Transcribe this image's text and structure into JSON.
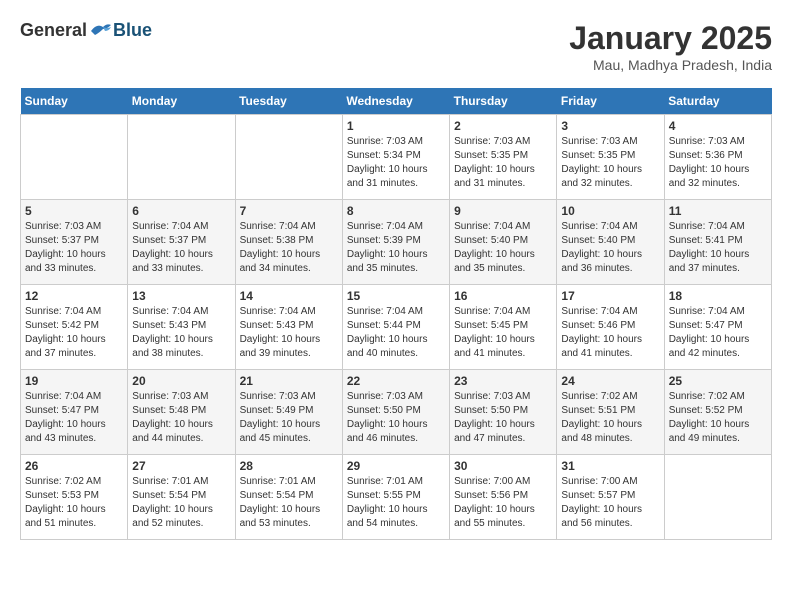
{
  "header": {
    "logo": {
      "general": "General",
      "blue": "Blue"
    },
    "title": "January 2025",
    "location": "Mau, Madhya Pradesh, India"
  },
  "days_of_week": [
    "Sunday",
    "Monday",
    "Tuesday",
    "Wednesday",
    "Thursday",
    "Friday",
    "Saturday"
  ],
  "weeks": [
    [
      {
        "day": "",
        "info": ""
      },
      {
        "day": "",
        "info": ""
      },
      {
        "day": "",
        "info": ""
      },
      {
        "day": "1",
        "info": "Sunrise: 7:03 AM\nSunset: 5:34 PM\nDaylight: 10 hours\nand 31 minutes."
      },
      {
        "day": "2",
        "info": "Sunrise: 7:03 AM\nSunset: 5:35 PM\nDaylight: 10 hours\nand 31 minutes."
      },
      {
        "day": "3",
        "info": "Sunrise: 7:03 AM\nSunset: 5:35 PM\nDaylight: 10 hours\nand 32 minutes."
      },
      {
        "day": "4",
        "info": "Sunrise: 7:03 AM\nSunset: 5:36 PM\nDaylight: 10 hours\nand 32 minutes."
      }
    ],
    [
      {
        "day": "5",
        "info": "Sunrise: 7:03 AM\nSunset: 5:37 PM\nDaylight: 10 hours\nand 33 minutes."
      },
      {
        "day": "6",
        "info": "Sunrise: 7:04 AM\nSunset: 5:37 PM\nDaylight: 10 hours\nand 33 minutes."
      },
      {
        "day": "7",
        "info": "Sunrise: 7:04 AM\nSunset: 5:38 PM\nDaylight: 10 hours\nand 34 minutes."
      },
      {
        "day": "8",
        "info": "Sunrise: 7:04 AM\nSunset: 5:39 PM\nDaylight: 10 hours\nand 35 minutes."
      },
      {
        "day": "9",
        "info": "Sunrise: 7:04 AM\nSunset: 5:40 PM\nDaylight: 10 hours\nand 35 minutes."
      },
      {
        "day": "10",
        "info": "Sunrise: 7:04 AM\nSunset: 5:40 PM\nDaylight: 10 hours\nand 36 minutes."
      },
      {
        "day": "11",
        "info": "Sunrise: 7:04 AM\nSunset: 5:41 PM\nDaylight: 10 hours\nand 37 minutes."
      }
    ],
    [
      {
        "day": "12",
        "info": "Sunrise: 7:04 AM\nSunset: 5:42 PM\nDaylight: 10 hours\nand 37 minutes."
      },
      {
        "day": "13",
        "info": "Sunrise: 7:04 AM\nSunset: 5:43 PM\nDaylight: 10 hours\nand 38 minutes."
      },
      {
        "day": "14",
        "info": "Sunrise: 7:04 AM\nSunset: 5:43 PM\nDaylight: 10 hours\nand 39 minutes."
      },
      {
        "day": "15",
        "info": "Sunrise: 7:04 AM\nSunset: 5:44 PM\nDaylight: 10 hours\nand 40 minutes."
      },
      {
        "day": "16",
        "info": "Sunrise: 7:04 AM\nSunset: 5:45 PM\nDaylight: 10 hours\nand 41 minutes."
      },
      {
        "day": "17",
        "info": "Sunrise: 7:04 AM\nSunset: 5:46 PM\nDaylight: 10 hours\nand 41 minutes."
      },
      {
        "day": "18",
        "info": "Sunrise: 7:04 AM\nSunset: 5:47 PM\nDaylight: 10 hours\nand 42 minutes."
      }
    ],
    [
      {
        "day": "19",
        "info": "Sunrise: 7:04 AM\nSunset: 5:47 PM\nDaylight: 10 hours\nand 43 minutes."
      },
      {
        "day": "20",
        "info": "Sunrise: 7:03 AM\nSunset: 5:48 PM\nDaylight: 10 hours\nand 44 minutes."
      },
      {
        "day": "21",
        "info": "Sunrise: 7:03 AM\nSunset: 5:49 PM\nDaylight: 10 hours\nand 45 minutes."
      },
      {
        "day": "22",
        "info": "Sunrise: 7:03 AM\nSunset: 5:50 PM\nDaylight: 10 hours\nand 46 minutes."
      },
      {
        "day": "23",
        "info": "Sunrise: 7:03 AM\nSunset: 5:50 PM\nDaylight: 10 hours\nand 47 minutes."
      },
      {
        "day": "24",
        "info": "Sunrise: 7:02 AM\nSunset: 5:51 PM\nDaylight: 10 hours\nand 48 minutes."
      },
      {
        "day": "25",
        "info": "Sunrise: 7:02 AM\nSunset: 5:52 PM\nDaylight: 10 hours\nand 49 minutes."
      }
    ],
    [
      {
        "day": "26",
        "info": "Sunrise: 7:02 AM\nSunset: 5:53 PM\nDaylight: 10 hours\nand 51 minutes."
      },
      {
        "day": "27",
        "info": "Sunrise: 7:01 AM\nSunset: 5:54 PM\nDaylight: 10 hours\nand 52 minutes."
      },
      {
        "day": "28",
        "info": "Sunrise: 7:01 AM\nSunset: 5:54 PM\nDaylight: 10 hours\nand 53 minutes."
      },
      {
        "day": "29",
        "info": "Sunrise: 7:01 AM\nSunset: 5:55 PM\nDaylight: 10 hours\nand 54 minutes."
      },
      {
        "day": "30",
        "info": "Sunrise: 7:00 AM\nSunset: 5:56 PM\nDaylight: 10 hours\nand 55 minutes."
      },
      {
        "day": "31",
        "info": "Sunrise: 7:00 AM\nSunset: 5:57 PM\nDaylight: 10 hours\nand 56 minutes."
      },
      {
        "day": "",
        "info": ""
      }
    ]
  ]
}
